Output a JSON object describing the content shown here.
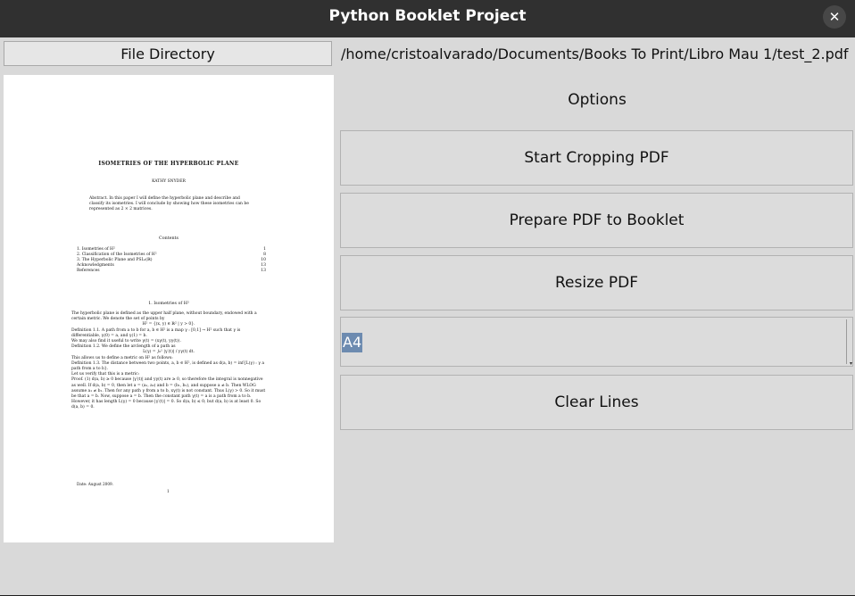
{
  "window": {
    "title": "Python Booklet Project",
    "close_glyph": "✕"
  },
  "file_directory": {
    "button_label": "File Directory",
    "path": "/home/cristoalvarado/Documents/Books To Print/Libro Mau 1/test_2.pdf"
  },
  "preview": {
    "title": "ISOMETRIES OF THE HYPERBOLIC PLANE",
    "author": "KATHY SNYDER",
    "abstract": "Abstract. In this paper I will define the hyperbolic plane and describe and classify its isometries. I will conclude by showing how these isometries can be represented as 2 × 2 matrices.",
    "contents_heading": "Contents",
    "toc": [
      {
        "label": "1.   Isometries of H²",
        "page": "1"
      },
      {
        "label": "2.   Classification of the Isometries of H²",
        "page": "8"
      },
      {
        "label": "3.   The Hyperbolic Plane and PSL₂(ℝ)",
        "page": "10"
      },
      {
        "label": "Acknowledgments",
        "page": "13"
      },
      {
        "label": "References",
        "page": "13"
      }
    ],
    "section_heading": "1. Isometries of H²",
    "body": [
      "The hyperbolic plane is defined as the upper half plane, without boundary, endowed with a certain metric. We denote the set of points by",
      "H² = {(x, y) ∈ ℝ² | y > 0}.",
      "Definition 1.1. A path from a to b for a, b ∈ H² is a map γ : [0,1] → H² such that γ is differentiable, γ(0) = a, and γ(1) = b.",
      "We may also find it useful to write γ(t) = (xγ(t), yγ(t)).",
      "Definition 1.2. We define the arclength of a path as",
      "L(γ) = ∫₀¹ |γ′(t)| / yγ(t) dt.",
      "This allows us to define a metric on H² as follows:",
      "Definition 1.3. The distance between two points, a, b ∈ H², is defined as d(a, b) = inf{L(γ) : γ a path from a to b}.",
      "Let us verify that this is a metric:",
      "Proof. (1) d(a, b) ≥ 0 because |γ′(t)| and yγ(t) are ≥ 0, so therefore the integral is nonnegative as well. If d(a, b) = 0, then let a = (a₁, a₂) and b = (b₁, b₂), and suppose a ≠ b. Then WLOG assume a₁ ≠ b₁. Then for any path γ from a to b, xγ(t) is not constant. Thus L(γ) > 0. So it must be that a = b. Now, suppose a = b. Then the constant path γ(t) = a is a path from a to b. However, it has length L(γ) = 0 because |γ′(t)| = 0. So d(a, b) ≤ 0; but d(a, b) is at least 0. So d(a, b) = 0."
    ],
    "date": "Date: August 2009.",
    "page_number": "1"
  },
  "options": {
    "label": "Options",
    "start_cropping": "Start Cropping PDF",
    "prepare_booklet": "Prepare PDF to Booklet",
    "resize": "Resize PDF",
    "paper_size": "A4",
    "clear_lines": "Clear Lines"
  },
  "colors": {
    "titlebar": "#303030",
    "background": "#d9d9d9",
    "selection": "#6d8bb0"
  }
}
